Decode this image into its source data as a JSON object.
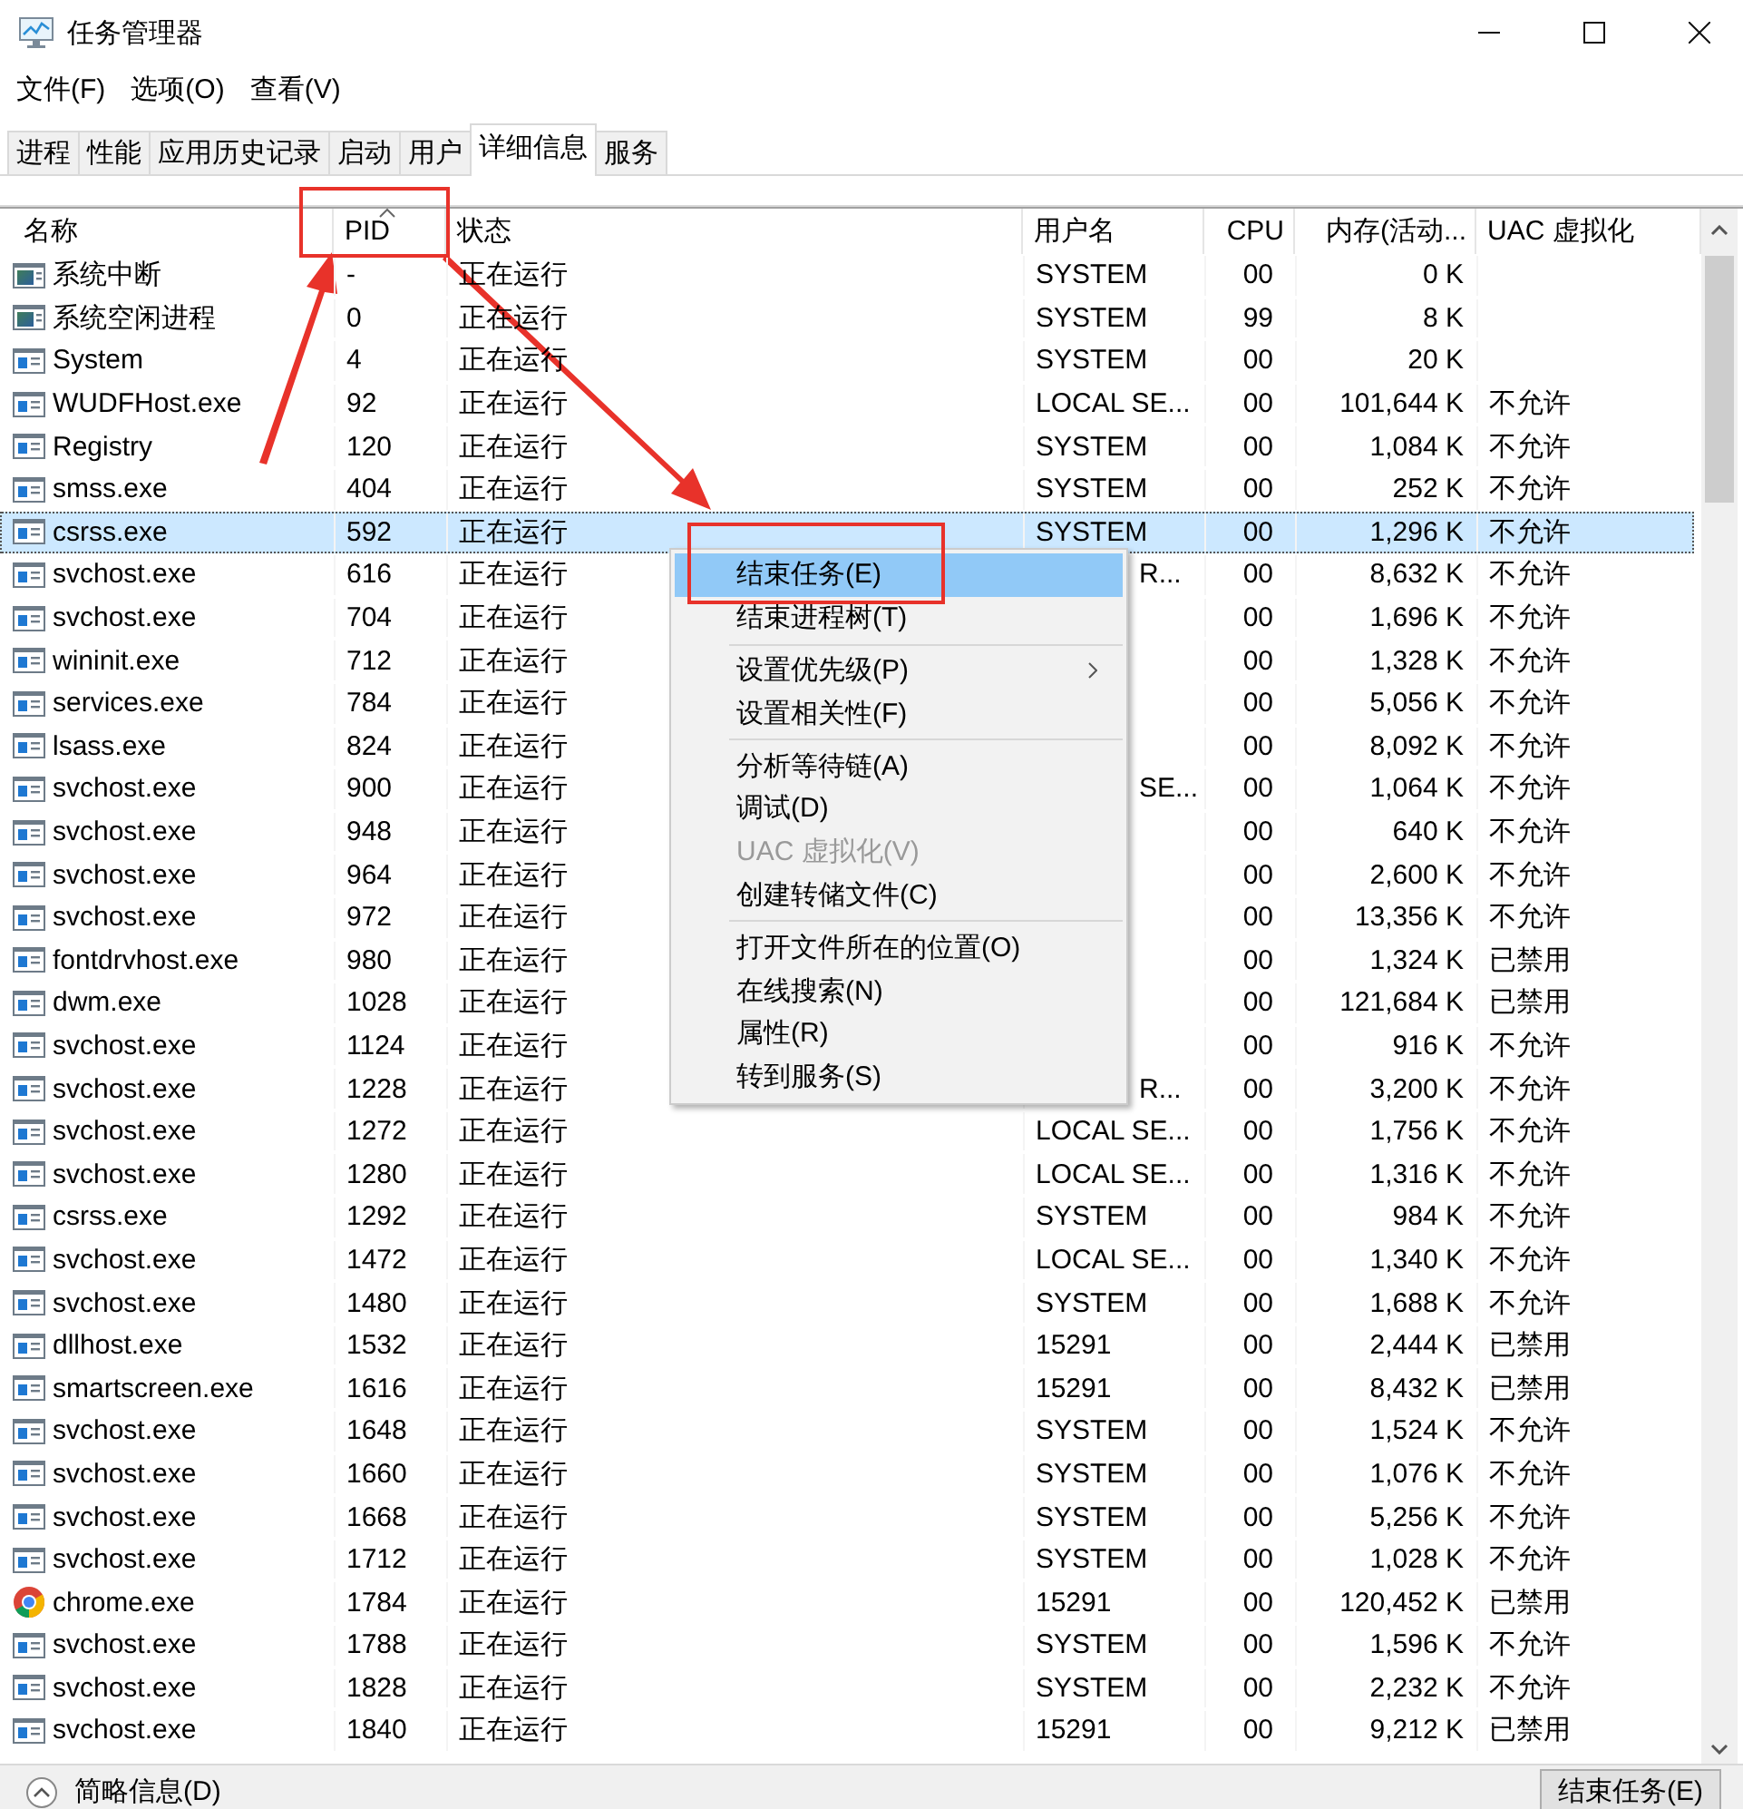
{
  "window": {
    "title": "任务管理器"
  },
  "menu_bar": [
    "文件(F)",
    "选项(O)",
    "查看(V)"
  ],
  "tabs": [
    {
      "label": "进程",
      "selected": false
    },
    {
      "label": "性能",
      "selected": false
    },
    {
      "label": "应用历史记录",
      "selected": false
    },
    {
      "label": "启动",
      "selected": false
    },
    {
      "label": "用户",
      "selected": false
    },
    {
      "label": "详细信息",
      "selected": true
    },
    {
      "label": "服务",
      "selected": false
    }
  ],
  "table": {
    "columns": [
      {
        "label": "名称",
        "sorted": false
      },
      {
        "label": "PID",
        "sorted": true
      },
      {
        "label": "状态",
        "sorted": false
      },
      {
        "label": "用户名",
        "sorted": false
      },
      {
        "label": "CPU",
        "sorted": false
      },
      {
        "label": "内存(活动...",
        "sorted": false
      },
      {
        "label": "UAC 虚拟化",
        "sorted": false
      }
    ],
    "rows": [
      {
        "kind": "system",
        "name": "系统中断",
        "pid": "-",
        "status": "正在运行",
        "user": "SYSTEM",
        "cpu": "00",
        "memory": "0 K",
        "selected": false
      },
      {
        "kind": "system",
        "name": "系统空闲进程",
        "pid": "0",
        "status": "正在运行",
        "user": "SYSTEM",
        "cpu": "99",
        "memory": "8 K",
        "selected": false
      },
      {
        "kind": "app",
        "name": "System",
        "pid": "4",
        "status": "正在运行",
        "user": "SYSTEM",
        "cpu": "00",
        "memory": "20 K",
        "selected": false
      },
      {
        "kind": "app",
        "name": "WUDFHost.exe",
        "pid": "92",
        "status": "正在运行",
        "user": "LOCAL SE...",
        "cpu": "00",
        "memory": "101,644 K",
        "uac": "不允许",
        "selected": false
      },
      {
        "kind": "app",
        "name": "Registry",
        "pid": "120",
        "status": "正在运行",
        "user": "SYSTEM",
        "cpu": "00",
        "memory": "1,084 K",
        "uac": "不允许",
        "selected": false
      },
      {
        "kind": "app",
        "name": "smss.exe",
        "pid": "404",
        "status": "正在运行",
        "user": "SYSTEM",
        "cpu": "00",
        "memory": "252 K",
        "uac": "不允许",
        "selected": false
      },
      {
        "kind": "app",
        "name": "csrss.exe",
        "pid": "592",
        "status": "正在运行",
        "user": "SYSTEM",
        "cpu": "00",
        "memory": "1,296 K",
        "uac": "不允许",
        "selected": true
      },
      {
        "kind": "app",
        "name": "svchost.exe",
        "pid": "616",
        "status": "正在运行",
        "user": "R...",
        "cpu": "00",
        "memory": "8,632 K",
        "uac": "不允许",
        "selected": false
      },
      {
        "kind": "app",
        "name": "svchost.exe",
        "pid": "704",
        "status": "正在运行",
        "cpu": "00",
        "memory": "1,696 K",
        "uac": "不允许",
        "selected": false
      },
      {
        "kind": "app",
        "name": "wininit.exe",
        "pid": "712",
        "status": "正在运行",
        "cpu": "00",
        "memory": "1,328 K",
        "uac": "不允许",
        "selected": false
      },
      {
        "kind": "app",
        "name": "services.exe",
        "pid": "784",
        "status": "正在运行",
        "cpu": "00",
        "memory": "5,056 K",
        "uac": "不允许",
        "selected": false
      },
      {
        "kind": "app",
        "name": "lsass.exe",
        "pid": "824",
        "status": "正在运行",
        "cpu": "00",
        "memory": "8,092 K",
        "uac": "不允许",
        "selected": false
      },
      {
        "kind": "app",
        "name": "svchost.exe",
        "pid": "900",
        "status": "正在运行",
        "user": "SE...",
        "cpu": "00",
        "memory": "1,064 K",
        "uac": "不允许",
        "selected": false
      },
      {
        "kind": "app",
        "name": "svchost.exe",
        "pid": "948",
        "status": "正在运行",
        "cpu": "00",
        "memory": "640 K",
        "uac": "不允许",
        "selected": false
      },
      {
        "kind": "app",
        "name": "svchost.exe",
        "pid": "964",
        "status": "正在运行",
        "cpu": "00",
        "memory": "2,600 K",
        "uac": "不允许",
        "selected": false
      },
      {
        "kind": "app",
        "name": "svchost.exe",
        "pid": "972",
        "status": "正在运行",
        "cpu": "00",
        "memory": "13,356 K",
        "uac": "不允许",
        "selected": false
      },
      {
        "kind": "app",
        "name": "fontdrvhost.exe",
        "pid": "980",
        "status": "正在运行",
        "cpu": "00",
        "memory": "1,324 K",
        "uac": "已禁用",
        "selected": false
      },
      {
        "kind": "app",
        "name": "dwm.exe",
        "pid": "1028",
        "status": "正在运行",
        "cpu": "00",
        "memory": "121,684 K",
        "uac": "已禁用",
        "selected": false
      },
      {
        "kind": "app",
        "name": "svchost.exe",
        "pid": "1124",
        "status": "正在运行",
        "cpu": "00",
        "memory": "916 K",
        "uac": "不允许",
        "selected": false
      },
      {
        "kind": "app",
        "name": "svchost.exe",
        "pid": "1228",
        "status": "正在运行",
        "user": "R...",
        "cpu": "00",
        "memory": "3,200 K",
        "uac": "不允许",
        "selected": false
      },
      {
        "kind": "app",
        "name": "svchost.exe",
        "pid": "1272",
        "status": "正在运行",
        "user": "LOCAL SE...",
        "cpu": "00",
        "memory": "1,756 K",
        "uac": "不允许",
        "selected": false
      },
      {
        "kind": "app",
        "name": "svchost.exe",
        "pid": "1280",
        "status": "正在运行",
        "user": "LOCAL SE...",
        "cpu": "00",
        "memory": "1,316 K",
        "uac": "不允许",
        "selected": false
      },
      {
        "kind": "app",
        "name": "csrss.exe",
        "pid": "1292",
        "status": "正在运行",
        "user": "SYSTEM",
        "cpu": "00",
        "memory": "984 K",
        "uac": "不允许",
        "selected": false
      },
      {
        "kind": "app",
        "name": "svchost.exe",
        "pid": "1472",
        "status": "正在运行",
        "user": "LOCAL SE...",
        "cpu": "00",
        "memory": "1,340 K",
        "uac": "不允许",
        "selected": false
      },
      {
        "kind": "app",
        "name": "svchost.exe",
        "pid": "1480",
        "status": "正在运行",
        "user": "SYSTEM",
        "cpu": "00",
        "memory": "1,688 K",
        "uac": "不允许",
        "selected": false
      },
      {
        "kind": "app",
        "name": "dllhost.exe",
        "pid": "1532",
        "status": "正在运行",
        "user": "15291",
        "cpu": "00",
        "memory": "2,444 K",
        "uac": "已禁用",
        "selected": false
      },
      {
        "kind": "app",
        "name": "smartscreen.exe",
        "pid": "1616",
        "status": "正在运行",
        "user": "15291",
        "cpu": "00",
        "memory": "8,432 K",
        "uac": "已禁用",
        "selected": false
      },
      {
        "kind": "app",
        "name": "svchost.exe",
        "pid": "1648",
        "status": "正在运行",
        "user": "SYSTEM",
        "cpu": "00",
        "memory": "1,524 K",
        "uac": "不允许",
        "selected": false
      },
      {
        "kind": "app",
        "name": "svchost.exe",
        "pid": "1660",
        "status": "正在运行",
        "user": "SYSTEM",
        "cpu": "00",
        "memory": "1,076 K",
        "uac": "不允许",
        "selected": false
      },
      {
        "kind": "app",
        "name": "svchost.exe",
        "pid": "1668",
        "status": "正在运行",
        "user": "SYSTEM",
        "cpu": "00",
        "memory": "5,256 K",
        "uac": "不允许",
        "selected": false
      },
      {
        "kind": "app",
        "name": "svchost.exe",
        "pid": "1712",
        "status": "正在运行",
        "user": "SYSTEM",
        "cpu": "00",
        "memory": "1,028 K",
        "uac": "不允许",
        "selected": false
      },
      {
        "kind": "chrome",
        "name": "chrome.exe",
        "pid": "1784",
        "status": "正在运行",
        "user": "15291",
        "cpu": "00",
        "memory": "120,452 K",
        "uac": "已禁用",
        "selected": false
      },
      {
        "kind": "app",
        "name": "svchost.exe",
        "pid": "1788",
        "status": "正在运行",
        "user": "SYSTEM",
        "cpu": "00",
        "memory": "1,596 K",
        "uac": "不允许",
        "selected": false
      },
      {
        "kind": "app",
        "name": "svchost.exe",
        "pid": "1828",
        "status": "正在运行",
        "user": "SYSTEM",
        "cpu": "00",
        "memory": "2,232 K",
        "uac": "不允许",
        "selected": false
      },
      {
        "kind": "app",
        "name": "svchost.exe",
        "pid": "1840",
        "status": "正在运行",
        "user": "15291",
        "cpu": "00",
        "memory": "9,212 K",
        "uac": "已禁用",
        "selected": false
      }
    ]
  },
  "context_menu": {
    "groups": [
      [
        {
          "label": "结束任务(E)",
          "selected": true,
          "disabled": false,
          "submenu": false
        },
        {
          "label": "结束进程树(T)",
          "selected": false,
          "disabled": false,
          "submenu": false
        }
      ],
      [
        {
          "label": "设置优先级(P)",
          "selected": false,
          "disabled": false,
          "submenu": true
        },
        {
          "label": "设置相关性(F)",
          "selected": false,
          "disabled": false,
          "submenu": false
        }
      ],
      [
        {
          "label": "分析等待链(A)",
          "selected": false,
          "disabled": false,
          "submenu": false
        },
        {
          "label": "调试(D)",
          "selected": false,
          "disabled": false,
          "submenu": false
        },
        {
          "label": "UAC 虚拟化(V)",
          "selected": false,
          "disabled": true,
          "submenu": false
        },
        {
          "label": "创建转储文件(C)",
          "selected": false,
          "disabled": false,
          "submenu": false
        }
      ],
      [
        {
          "label": "打开文件所在的位置(O)",
          "selected": false,
          "disabled": false,
          "submenu": false
        },
        {
          "label": "在线搜索(N)",
          "selected": false,
          "disabled": false,
          "submenu": false
        },
        {
          "label": "属性(R)",
          "selected": false,
          "disabled": false,
          "submenu": false
        },
        {
          "label": "转到服务(S)",
          "selected": false,
          "disabled": false,
          "submenu": false
        }
      ]
    ]
  },
  "footer": {
    "details_toggle": "简略信息(D)",
    "end_task_button": "结束任务(E)"
  }
}
